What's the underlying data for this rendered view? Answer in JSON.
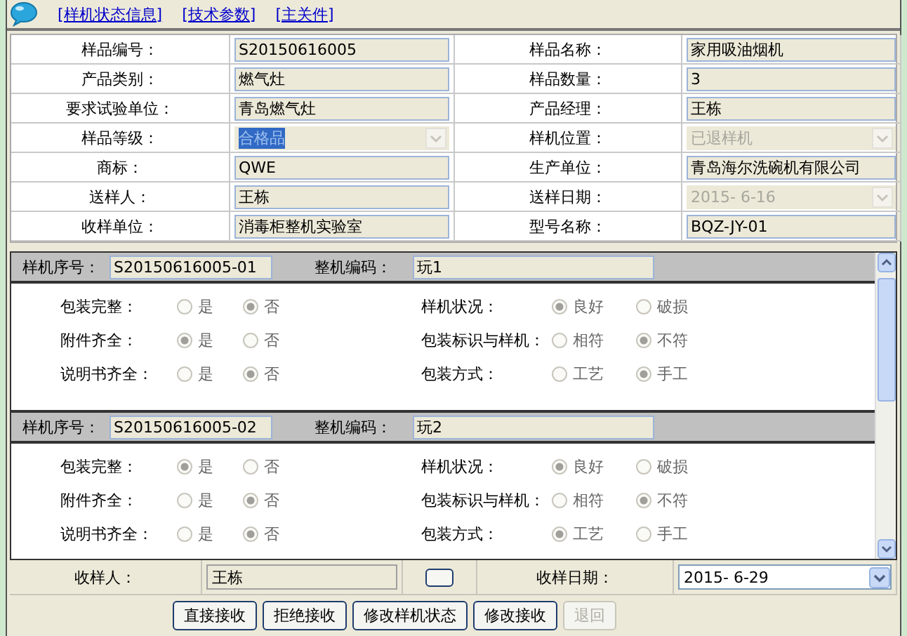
{
  "links": [
    {
      "label": "[样机状态信息]"
    },
    {
      "label": "[技术参数]"
    },
    {
      "label": "[主关件]"
    }
  ],
  "sample_info": {
    "fields": [
      {
        "label": "样品编号：",
        "value": "S20150616005",
        "kind": "text",
        "disabled": false,
        "highlighted": false
      },
      {
        "label": "样品名称：",
        "value": "家用吸油烟机",
        "kind": "text",
        "disabled": false,
        "highlighted": false
      },
      {
        "label": "产品类别：",
        "value": "燃气灶",
        "kind": "text",
        "disabled": false,
        "highlighted": false
      },
      {
        "label": "样品数量：",
        "value": "3",
        "kind": "text",
        "disabled": false,
        "highlighted": false
      },
      {
        "label": "要求试验单位：",
        "value": "青岛燃气灶",
        "kind": "text",
        "disabled": false,
        "highlighted": false
      },
      {
        "label": "产品经理：",
        "value": "王栋",
        "kind": "text",
        "disabled": false,
        "highlighted": false
      },
      {
        "label": "样品等级：",
        "value": "合格品",
        "kind": "select",
        "disabled": false,
        "highlighted": true
      },
      {
        "label": "样机位置：",
        "value": "已退样机",
        "kind": "select",
        "disabled": true,
        "highlighted": false
      },
      {
        "label": "商标：",
        "value": "QWE",
        "kind": "text",
        "disabled": false,
        "highlighted": false
      },
      {
        "label": "生产单位：",
        "value": "青岛海尔洗碗机有限公司",
        "kind": "text",
        "disabled": false,
        "highlighted": false
      },
      {
        "label": "送样人：",
        "value": "王栋",
        "kind": "text",
        "disabled": false,
        "highlighted": false
      },
      {
        "label": "送样日期：",
        "value": "2015- 6-16",
        "kind": "select",
        "disabled": true,
        "highlighted": false
      },
      {
        "label": "收样单位：",
        "value": "消毒柜整机实验室",
        "kind": "text",
        "disabled": false,
        "highlighted": false
      },
      {
        "label": "型号名称：",
        "value": "BQZ-JY-01",
        "kind": "text",
        "disabled": false,
        "highlighted": false
      }
    ]
  },
  "samples": [
    {
      "serial_label": "样机序号：",
      "serial": "S20150616005-01",
      "code_label": "整机编码：",
      "code": "玩1",
      "checks": [
        {
          "label": "包装完整：",
          "options": [
            {
              "label": "是",
              "selected": false
            },
            {
              "label": "否",
              "selected": true
            }
          ]
        },
        {
          "label": "样机状况：",
          "options": [
            {
              "label": "良好",
              "selected": true
            },
            {
              "label": "破损",
              "selected": false
            }
          ]
        },
        {
          "label": "附件齐全：",
          "options": [
            {
              "label": "是",
              "selected": true
            },
            {
              "label": "否",
              "selected": false
            }
          ]
        },
        {
          "label": "包装标识与样机：",
          "options": [
            {
              "label": "相符",
              "selected": false
            },
            {
              "label": "不符",
              "selected": true
            }
          ]
        },
        {
          "label": "说明书齐全：",
          "options": [
            {
              "label": "是",
              "selected": false
            },
            {
              "label": "否",
              "selected": true
            }
          ]
        },
        {
          "label": "包装方式：",
          "options": [
            {
              "label": "工艺",
              "selected": false
            },
            {
              "label": "手工",
              "selected": true
            }
          ]
        }
      ]
    },
    {
      "serial_label": "样机序号：",
      "serial": "S20150616005-02",
      "code_label": "整机编码：",
      "code": "玩2",
      "checks": [
        {
          "label": "包装完整：",
          "options": [
            {
              "label": "是",
              "selected": true
            },
            {
              "label": "否",
              "selected": false
            }
          ]
        },
        {
          "label": "样机状况：",
          "options": [
            {
              "label": "良好",
              "selected": true
            },
            {
              "label": "破损",
              "selected": false
            }
          ]
        },
        {
          "label": "附件齐全：",
          "options": [
            {
              "label": "是",
              "selected": false
            },
            {
              "label": "否",
              "selected": true
            }
          ]
        },
        {
          "label": "包装标识与样机：",
          "options": [
            {
              "label": "相符",
              "selected": false
            },
            {
              "label": "不符",
              "selected": true
            }
          ]
        },
        {
          "label": "说明书齐全：",
          "options": [
            {
              "label": "是",
              "selected": false
            },
            {
              "label": "否",
              "selected": true
            }
          ]
        },
        {
          "label": "包装方式：",
          "options": [
            {
              "label": "工艺",
              "selected": true
            },
            {
              "label": "手工",
              "selected": false
            }
          ]
        }
      ]
    }
  ],
  "receipt": {
    "receiver_label": "收样人：",
    "receiver": "王栋",
    "date_label": "收样日期：",
    "date": "2015- 6-29"
  },
  "buttons": [
    {
      "label": "直接接收",
      "disabled": false
    },
    {
      "label": "拒绝接收",
      "disabled": false
    },
    {
      "label": "修改样机状态",
      "disabled": false
    },
    {
      "label": "修改接收",
      "disabled": false
    },
    {
      "label": "退回",
      "disabled": true
    }
  ]
}
